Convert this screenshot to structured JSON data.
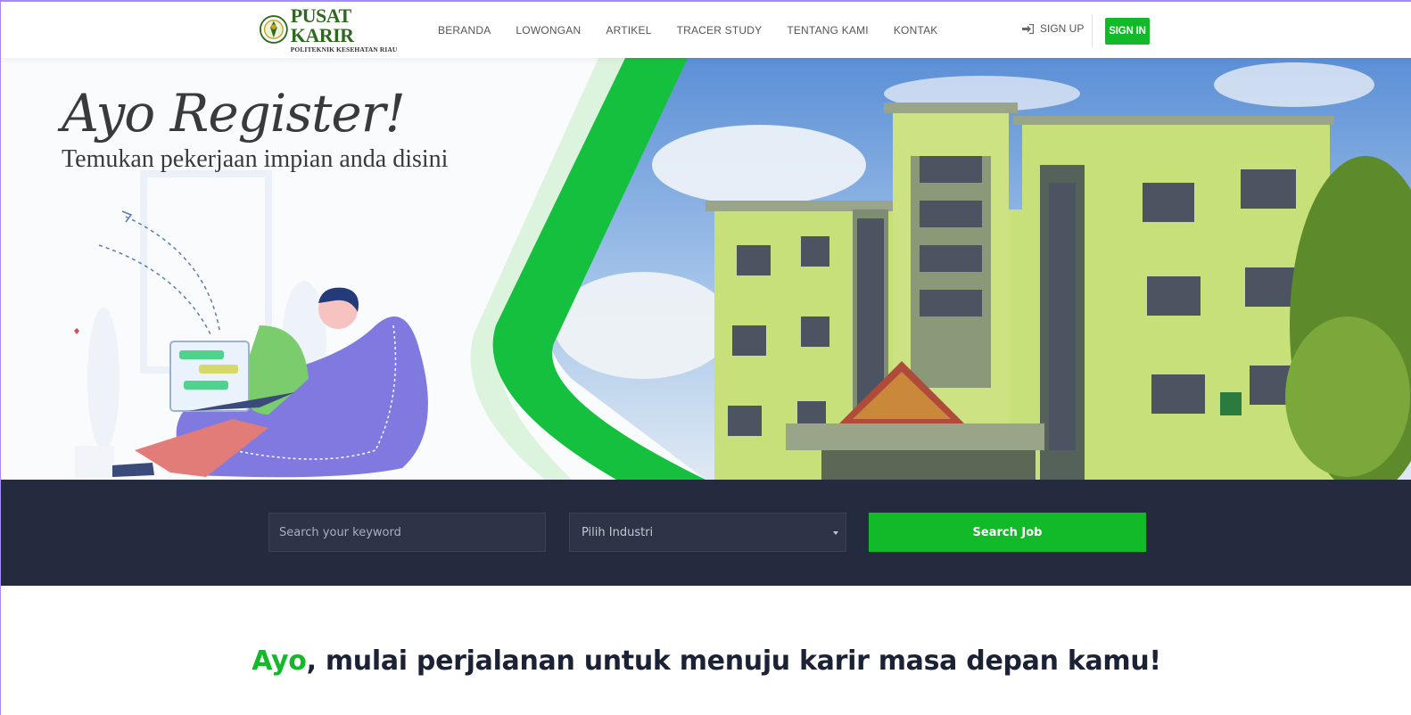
{
  "brand": {
    "title": "PUSAT KARIR",
    "subtitle": "POLITEKNIK KESEHATAN RIAU"
  },
  "nav": {
    "items": [
      "BERANDA",
      "LOWONGAN",
      "ARTIKEL",
      "TRACER STUDY",
      "TENTANG KAMI",
      "KONTAK"
    ],
    "signup_label": "SIGN UP",
    "signin_label": "SIGN IN"
  },
  "hero": {
    "title": "Ayo Register!",
    "subtitle": "Temukan pekerjaan impian anda disini"
  },
  "search": {
    "keyword_placeholder": "Search your keyword",
    "industry_selected": "Pilih Industri",
    "button_label": "Search Job"
  },
  "tagline": {
    "accent": "Ayo",
    "rest": ", mulai perjalanan untuk menuju karir masa depan kamu!"
  },
  "colors": {
    "accent_green": "#12b928",
    "dark_band": "#242b3f",
    "building": "#c8e07a"
  }
}
